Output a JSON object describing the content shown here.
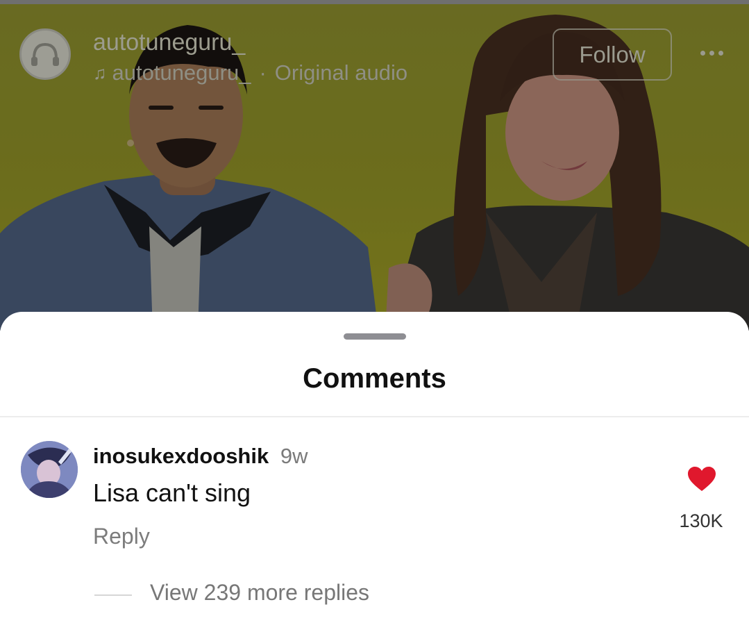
{
  "video": {
    "account": "autotuneguru_",
    "audio": {
      "icon": "music-note-icon",
      "artist": "autotuneguru_",
      "separator": "·",
      "label": "Original audio"
    },
    "follow_label": "Follow",
    "more_icon": "more-horizontal-icon",
    "avatar_icon": "headphones-icon"
  },
  "sheet": {
    "title": "Comments"
  },
  "comment": {
    "username": "inosukexdooshik",
    "time": "9w",
    "text": "Lisa can't sing",
    "reply_label": "Reply",
    "like_icon": "heart-filled-icon",
    "like_color": "#e0182d",
    "like_count": "130K",
    "view_replies": "View 239 more replies"
  }
}
